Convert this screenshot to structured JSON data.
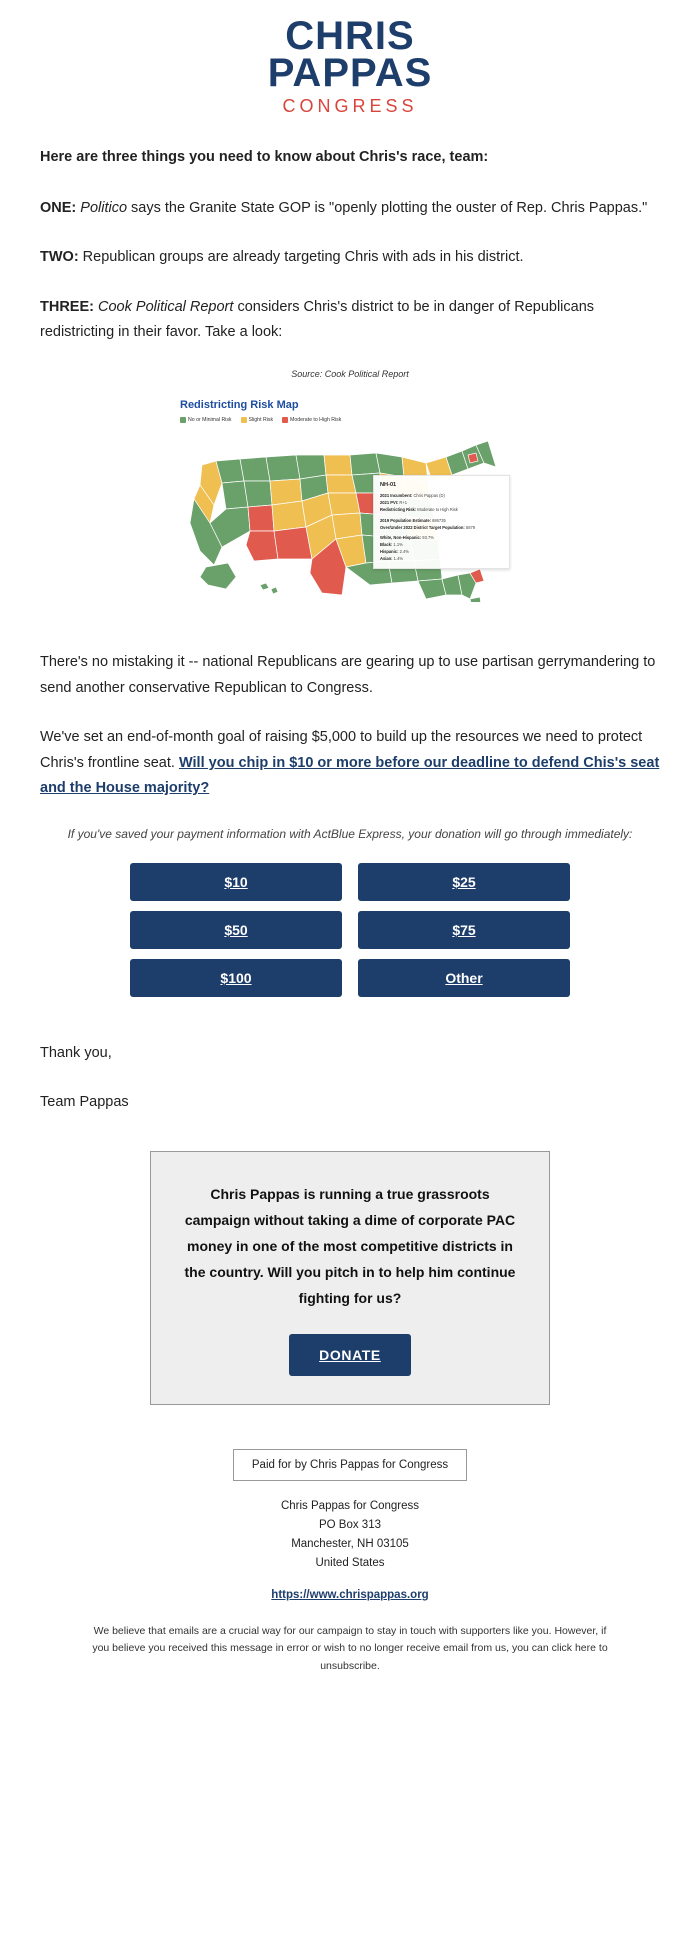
{
  "logo": {
    "line1": "CHRIS",
    "line2": "PAPPAS",
    "line3": "CONGRESS",
    "navy": "#1d3d6b",
    "red": "#d9453c"
  },
  "body": {
    "lead": "Here are three things you need to know about Chris's race, team:",
    "one_label": "ONE:",
    "one_italic": "Politico",
    "one_text": " says the Granite State GOP is \"openly plotting the ouster of Rep. Chris Pappas.\"",
    "two_label": "TWO:",
    "two_text": " Republican groups are already targeting Chris with ads in his district.",
    "three_label": "THREE:",
    "three_italic": "Cook Political Report",
    "three_text": " considers Chris's district to be in danger of Republicans redistricting in their favor. Take a look:",
    "para_gerrymander": "There's no mistaking it -- national Republicans are gearing up to use partisan gerrymandering to send another conservative Republican to Congress.",
    "para_goal_plain": "We've set an end-of-month goal of raising $5,000 to build up the resources we need to protect Chris's frontline seat. ",
    "para_goal_link": "Will you chip in $10 or more before our deadline to defend Chis's seat and the House majority?",
    "thank_you": "Thank you,",
    "team": "Team Pappas"
  },
  "map": {
    "source_caption": "Source: Cook Political Report",
    "title": "Redistricting Risk Map",
    "legend": [
      {
        "label": "No or Minimal Risk",
        "color": "#6aa06a"
      },
      {
        "label": "Slight Risk",
        "color": "#f0bf52"
      },
      {
        "label": "Moderate to High Risk",
        "color": "#e05a4e"
      }
    ],
    "tooltip": {
      "title": "NH-01",
      "rows": [
        {
          "key": "2021 Incumbent:",
          "value": " Chris Pappas (D)"
        },
        {
          "key": "2021 PVI:",
          "value": " R+1"
        },
        {
          "key": "Redistricting Risk:",
          "value": " Moderate to High Risk"
        }
      ],
      "rows2": [
        {
          "key": "2019 Population Estimate:",
          "value": " 686735"
        },
        {
          "key": "Over/Under 2022 District Target Population:",
          "value": " 5879"
        }
      ],
      "rows3": [
        {
          "key": "White, Non-Hispanic:",
          "value": " 93.7%"
        },
        {
          "key": "Black:",
          "value": " 1.1%"
        },
        {
          "key": "Hispanic:",
          "value": " 2.4%"
        },
        {
          "key": "Asian:",
          "value": " 1.4%"
        }
      ]
    }
  },
  "donation": {
    "actblue_note": "If you've saved your payment information with ActBlue Express, your donation will go through immediately:",
    "amounts": [
      "$10",
      "$25",
      "$50",
      "$75",
      "$100",
      "Other"
    ]
  },
  "callout": {
    "text": "Chris Pappas is running a true grassroots campaign without taking a dime of corporate PAC money in one of the most competitive districts in the country. Will you pitch in to help him continue fighting for us?",
    "button": "DONATE"
  },
  "footer": {
    "paid_for": "Paid for by Chris Pappas for Congress",
    "addr_line1": "Chris Pappas for Congress",
    "addr_line2": "PO Box 313",
    "addr_line3": "Manchester, NH 03105",
    "addr_line4": "United States",
    "website": "https://www.chrispappas.org",
    "disclaimer": "We believe that emails are a crucial way for our campaign to stay in touch with supporters like you. However, if you believe you received this message in error or wish to no longer receive email from us, you can click here to unsubscribe."
  },
  "chart_data": {
    "type": "map",
    "title": "Redistricting Risk Map",
    "source": "Cook Political Report",
    "categories": [
      "No or Minimal Risk",
      "Slight Risk",
      "Moderate to High Risk"
    ],
    "colors": [
      "#6aa06a",
      "#f0bf52",
      "#e05a4e"
    ],
    "highlighted_district": "NH-01",
    "highlighted_risk": "Moderate to High Risk",
    "states_slight_risk": [
      "WA",
      "OR",
      "MN",
      "IA",
      "MO",
      "CO",
      "KS",
      "OK",
      "AR",
      "LA",
      "MI",
      "OH",
      "PA",
      "NY",
      "NH",
      "FL",
      "NC",
      "VA"
    ],
    "states_high_risk": [
      "NM",
      "AZ",
      "TX",
      "IL",
      "NH"
    ],
    "states_minimal_risk": [
      "CA",
      "NV",
      "ID",
      "MT",
      "WY",
      "UT",
      "ND",
      "SD",
      "NE",
      "WI",
      "IN",
      "KY",
      "TN",
      "MS",
      "AL",
      "GA",
      "SC",
      "WV",
      "MD",
      "NJ",
      "CT",
      "RI",
      "MA",
      "VT",
      "ME",
      "AK",
      "HI",
      "DE"
    ]
  }
}
